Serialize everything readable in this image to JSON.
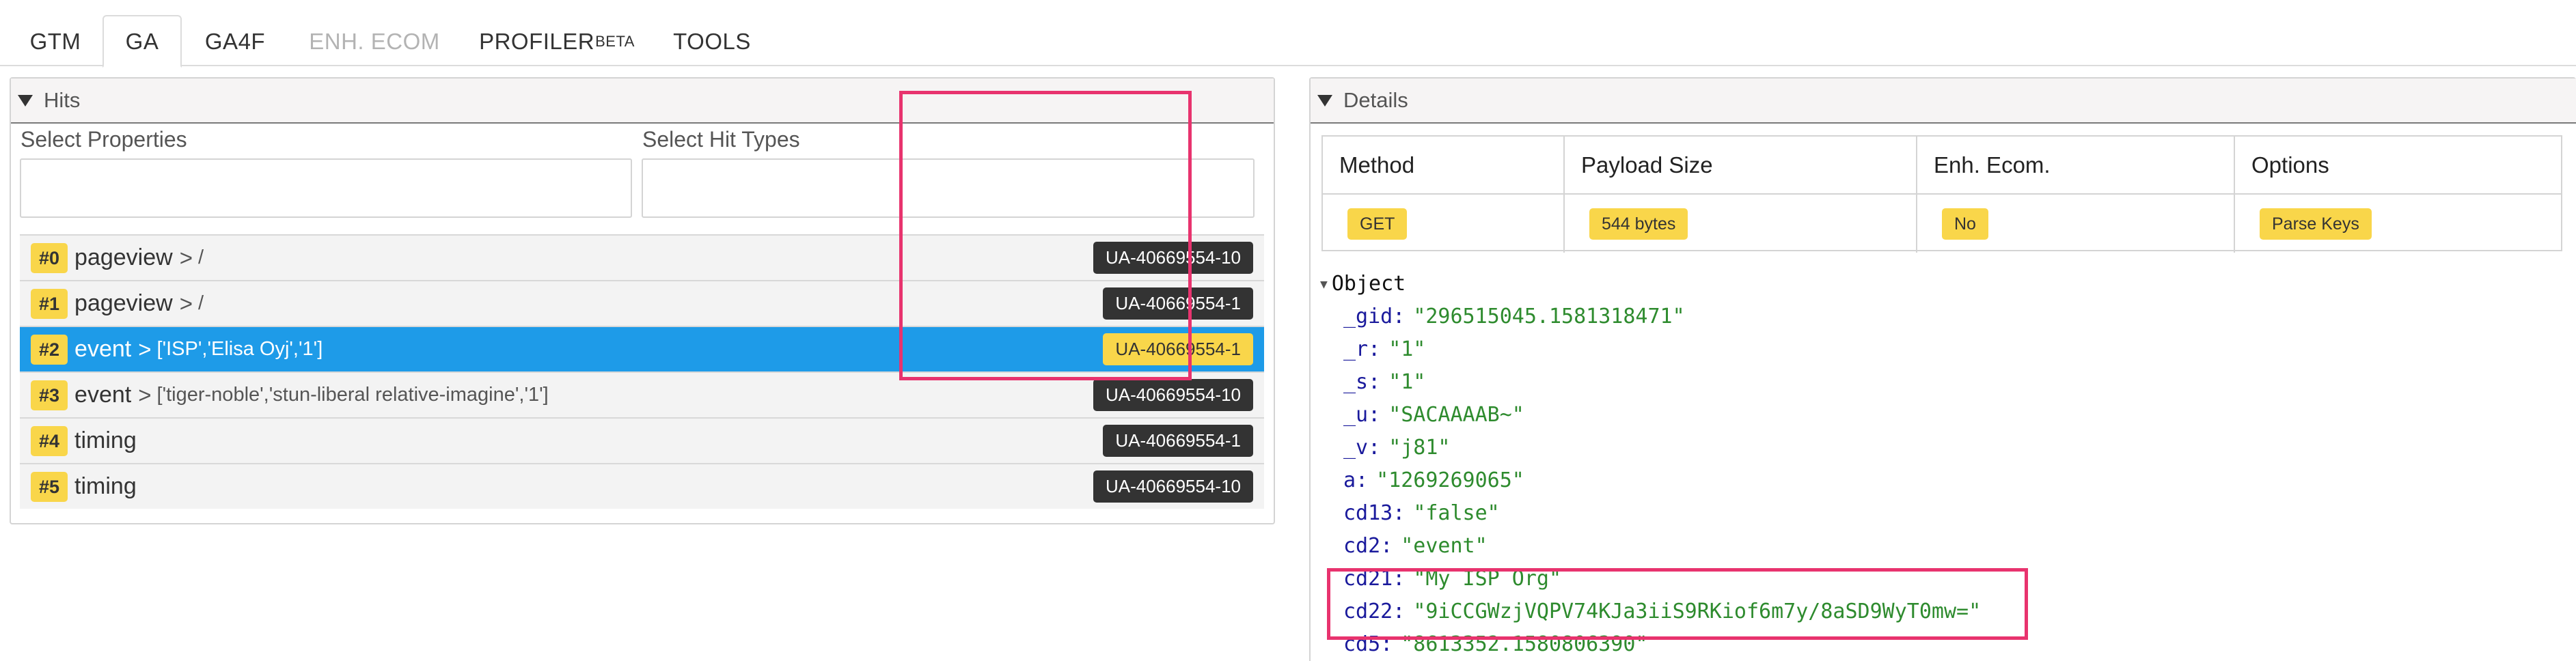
{
  "tabs": [
    {
      "label": "GTM",
      "state": "normal"
    },
    {
      "label": "GA",
      "state": "active"
    },
    {
      "label": "GA4F",
      "state": "normal"
    },
    {
      "label": "ENH. ECOM",
      "state": "disabled"
    },
    {
      "label": "PROFILER",
      "sub": "BETA",
      "state": "normal"
    },
    {
      "label": "TOOLS",
      "state": "normal"
    }
  ],
  "hits_panel": {
    "title": "Hits",
    "select_properties_label": "Select Properties",
    "select_hit_types_label": "Select Hit Types",
    "hits": [
      {
        "num": "#0",
        "type": "pageview",
        "sep": ">",
        "detail": "/",
        "tid": "UA-40669554-10",
        "selected": false
      },
      {
        "num": "#1",
        "type": "pageview",
        "sep": ">",
        "detail": "/",
        "tid": "UA-40669554-1",
        "selected": false
      },
      {
        "num": "#2",
        "type": "event",
        "sep": ">",
        "detail": "['ISP','Elisa Oyj','1']",
        "tid": "UA-40669554-1",
        "selected": true
      },
      {
        "num": "#3",
        "type": "event",
        "sep": ">",
        "detail": "['tiger-noble','stun-liberal relative-imagine','1']",
        "tid": "UA-40669554-10",
        "selected": false
      },
      {
        "num": "#4",
        "type": "timing",
        "sep": "",
        "detail": "",
        "tid": "UA-40669554-1",
        "selected": false
      },
      {
        "num": "#5",
        "type": "timing",
        "sep": "",
        "detail": "",
        "tid": "UA-40669554-10",
        "selected": false
      }
    ]
  },
  "details_panel": {
    "title": "Details",
    "table": {
      "headers": [
        "Method",
        "Payload Size",
        "Enh. Ecom.",
        "Options"
      ],
      "values": [
        "GET",
        "544 bytes",
        "No",
        "Parse Keys"
      ]
    },
    "object_label": "Object",
    "properties": [
      {
        "key": "_gid:",
        "value": "\"296515045.1581318471\""
      },
      {
        "key": "_r:",
        "value": "\"1\""
      },
      {
        "key": "_s:",
        "value": "\"1\""
      },
      {
        "key": "_u:",
        "value": "\"SACAAAAB~\""
      },
      {
        "key": "_v:",
        "value": "\"j81\""
      },
      {
        "key": "a:",
        "value": "\"1269269065\""
      },
      {
        "key": "cd13:",
        "value": "\"false\""
      },
      {
        "key": "cd2:",
        "value": "\"event\""
      },
      {
        "key": "cd21:",
        "value": "\"My ISP Org\""
      },
      {
        "key": "cd22:",
        "value": "\"9iCCGWzjVQPV74KJa3iiS9RKiof6m7y/8aSD9WyT0mw=\""
      },
      {
        "key": "cd5:",
        "value": "\"8613352.1580806390\""
      }
    ]
  },
  "colors": {
    "accent_selected": "#1e9be8",
    "badge_yellow": "#f9d64a",
    "annotation_pink": "#e8336e",
    "key_color": "#1a1a9c",
    "value_color": "#2e8b2e"
  }
}
